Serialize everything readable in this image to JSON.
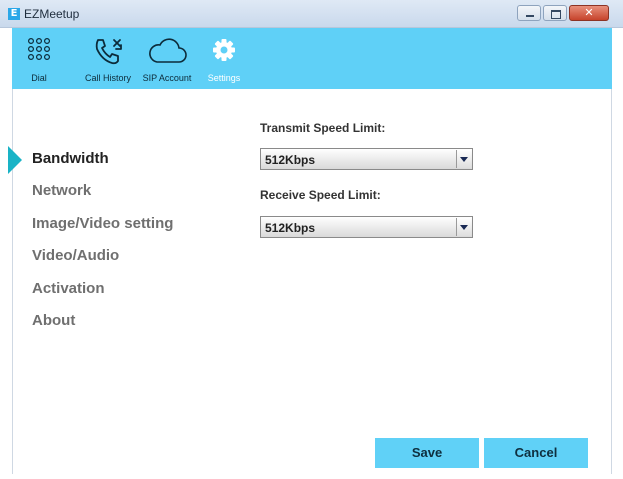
{
  "window": {
    "title": "EZMeetup",
    "logo_letter": "E"
  },
  "toolbar": {
    "items": [
      {
        "label": "Dial",
        "icon": "dial-grid-icon"
      },
      {
        "label": "Call History",
        "icon": "phone-history-icon"
      },
      {
        "label": "SIP Account",
        "icon": "cloud-icon"
      },
      {
        "label": "Settings",
        "icon": "gear-icon",
        "active": true
      }
    ]
  },
  "sidebar": {
    "items": [
      {
        "label": "Bandwidth",
        "active": true
      },
      {
        "label": "Network"
      },
      {
        "label": "Image/Video setting"
      },
      {
        "label": "Video/Audio"
      },
      {
        "label": "Activation"
      },
      {
        "label": "About"
      }
    ]
  },
  "form": {
    "transmit_label": "Transmit Speed Limit:",
    "transmit_value": "512Kbps",
    "receive_label": "Receive Speed Limit:",
    "receive_value": "512Kbps"
  },
  "buttons": {
    "save": "Save",
    "cancel": "Cancel"
  },
  "colors": {
    "toolbar": "#5fd0f7",
    "accent_marker": "#19b3c6",
    "button": "#60d1f7"
  }
}
